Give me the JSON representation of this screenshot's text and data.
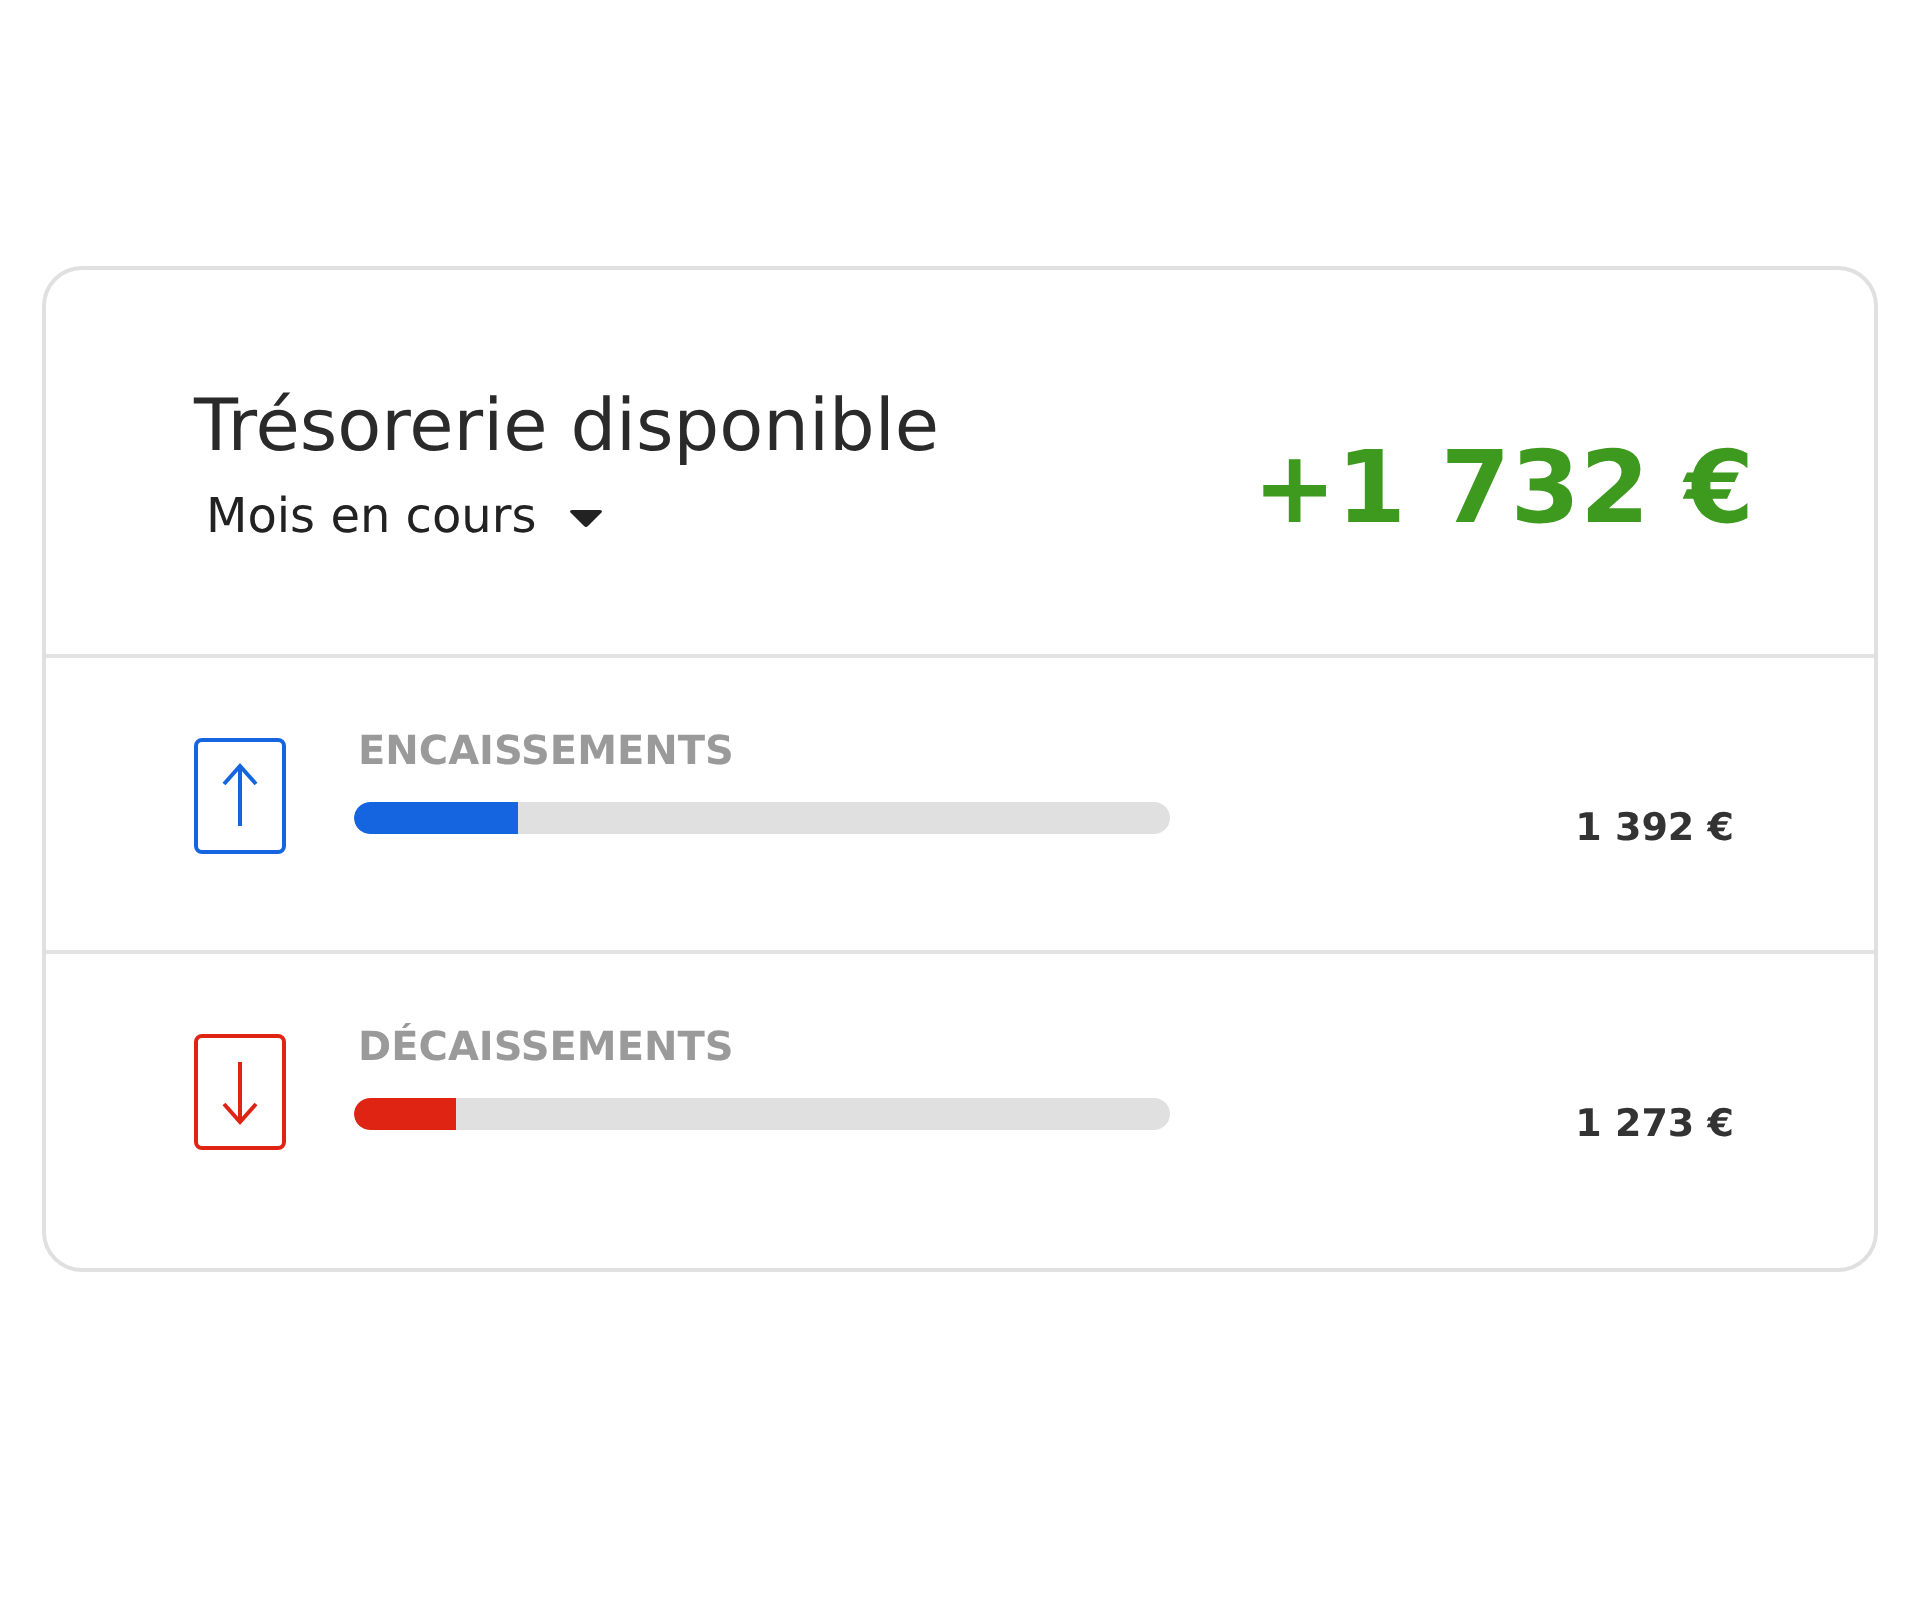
{
  "header": {
    "title": "Trésorerie disponible",
    "period": "Mois en cours",
    "total": "+1 732 €"
  },
  "flows": [
    {
      "kind": "in",
      "label": "ENCAISSEMENTS",
      "level": 0.2,
      "amount": "1 392 €"
    },
    {
      "kind": "out",
      "label": "DÉCAISSEMENTS",
      "level": 0.125,
      "amount": "1 273 €"
    }
  ]
}
